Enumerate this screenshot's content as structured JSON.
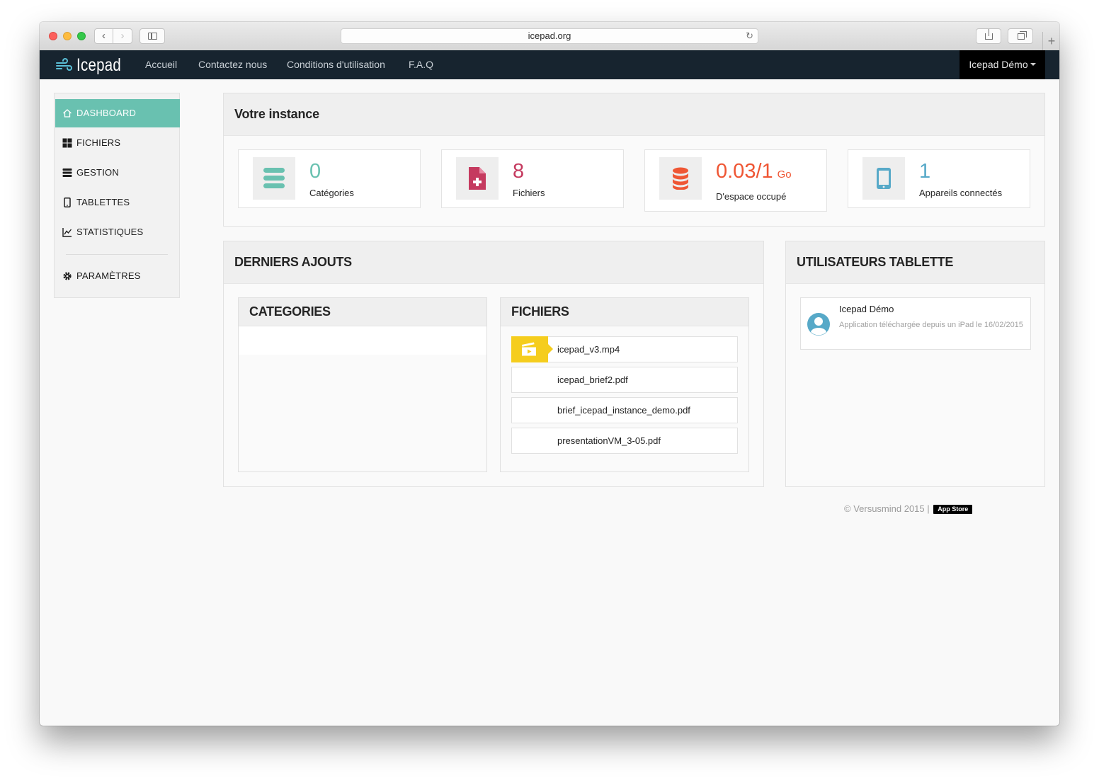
{
  "browser": {
    "url": "icepad.org"
  },
  "navbar": {
    "brand": "Icepad",
    "links": [
      "Accueil",
      "Contactez nous",
      "Conditions d'utilisation",
      "F.A.Q"
    ],
    "user_menu": "Icepad Démo"
  },
  "sidebar": {
    "items": [
      {
        "label": "DASHBOARD",
        "icon": "home-icon"
      },
      {
        "label": "FICHIERS",
        "icon": "grid-icon"
      },
      {
        "label": "GESTION",
        "icon": "bars-icon"
      },
      {
        "label": "TABLETTES",
        "icon": "tablet-icon"
      },
      {
        "label": "STATISTIQUES",
        "icon": "chart-icon"
      },
      {
        "label": "PARAMÈTRES",
        "icon": "gear-icon"
      }
    ],
    "active": "DASHBOARD"
  },
  "instance": {
    "title": "Votre instance",
    "stats": [
      {
        "value": "0",
        "label": "Catégories",
        "color": "#69c1b0",
        "icon": "list-icon"
      },
      {
        "value": "8",
        "label": "Fichiers",
        "color": "#c53a5f",
        "icon": "file-add-icon"
      },
      {
        "value": "0.03/1",
        "unit": "Go",
        "label": "D'espace occupé",
        "color": "#ef5634",
        "icon": "database-icon"
      },
      {
        "value": "1",
        "label": "Appareils connectés",
        "color": "#57a9c8",
        "icon": "tablet-icon"
      }
    ]
  },
  "recent": {
    "title": "DERNIERS AJOUTS",
    "categories_title": "CATEGORIES",
    "files_title": "FICHIERS",
    "files": [
      "icepad_v3.mp4",
      "icepad_brief2.pdf",
      "brief_icepad_instance_demo.pdf",
      "presentationVM_3-05.pdf"
    ]
  },
  "tablet_users": {
    "title": "UTILISATEURS TABLETTE",
    "users": [
      {
        "name": "Icepad Démo",
        "detail": "Application téléchargée depuis un iPad le 16/02/2015"
      }
    ]
  },
  "footer": {
    "copyright": "© Versusmind 2015 |",
    "badge": "App Store"
  },
  "colors": {
    "accent": "#69c1b0",
    "navbar": "#17242f",
    "video_tag": "#f5cd1d"
  }
}
